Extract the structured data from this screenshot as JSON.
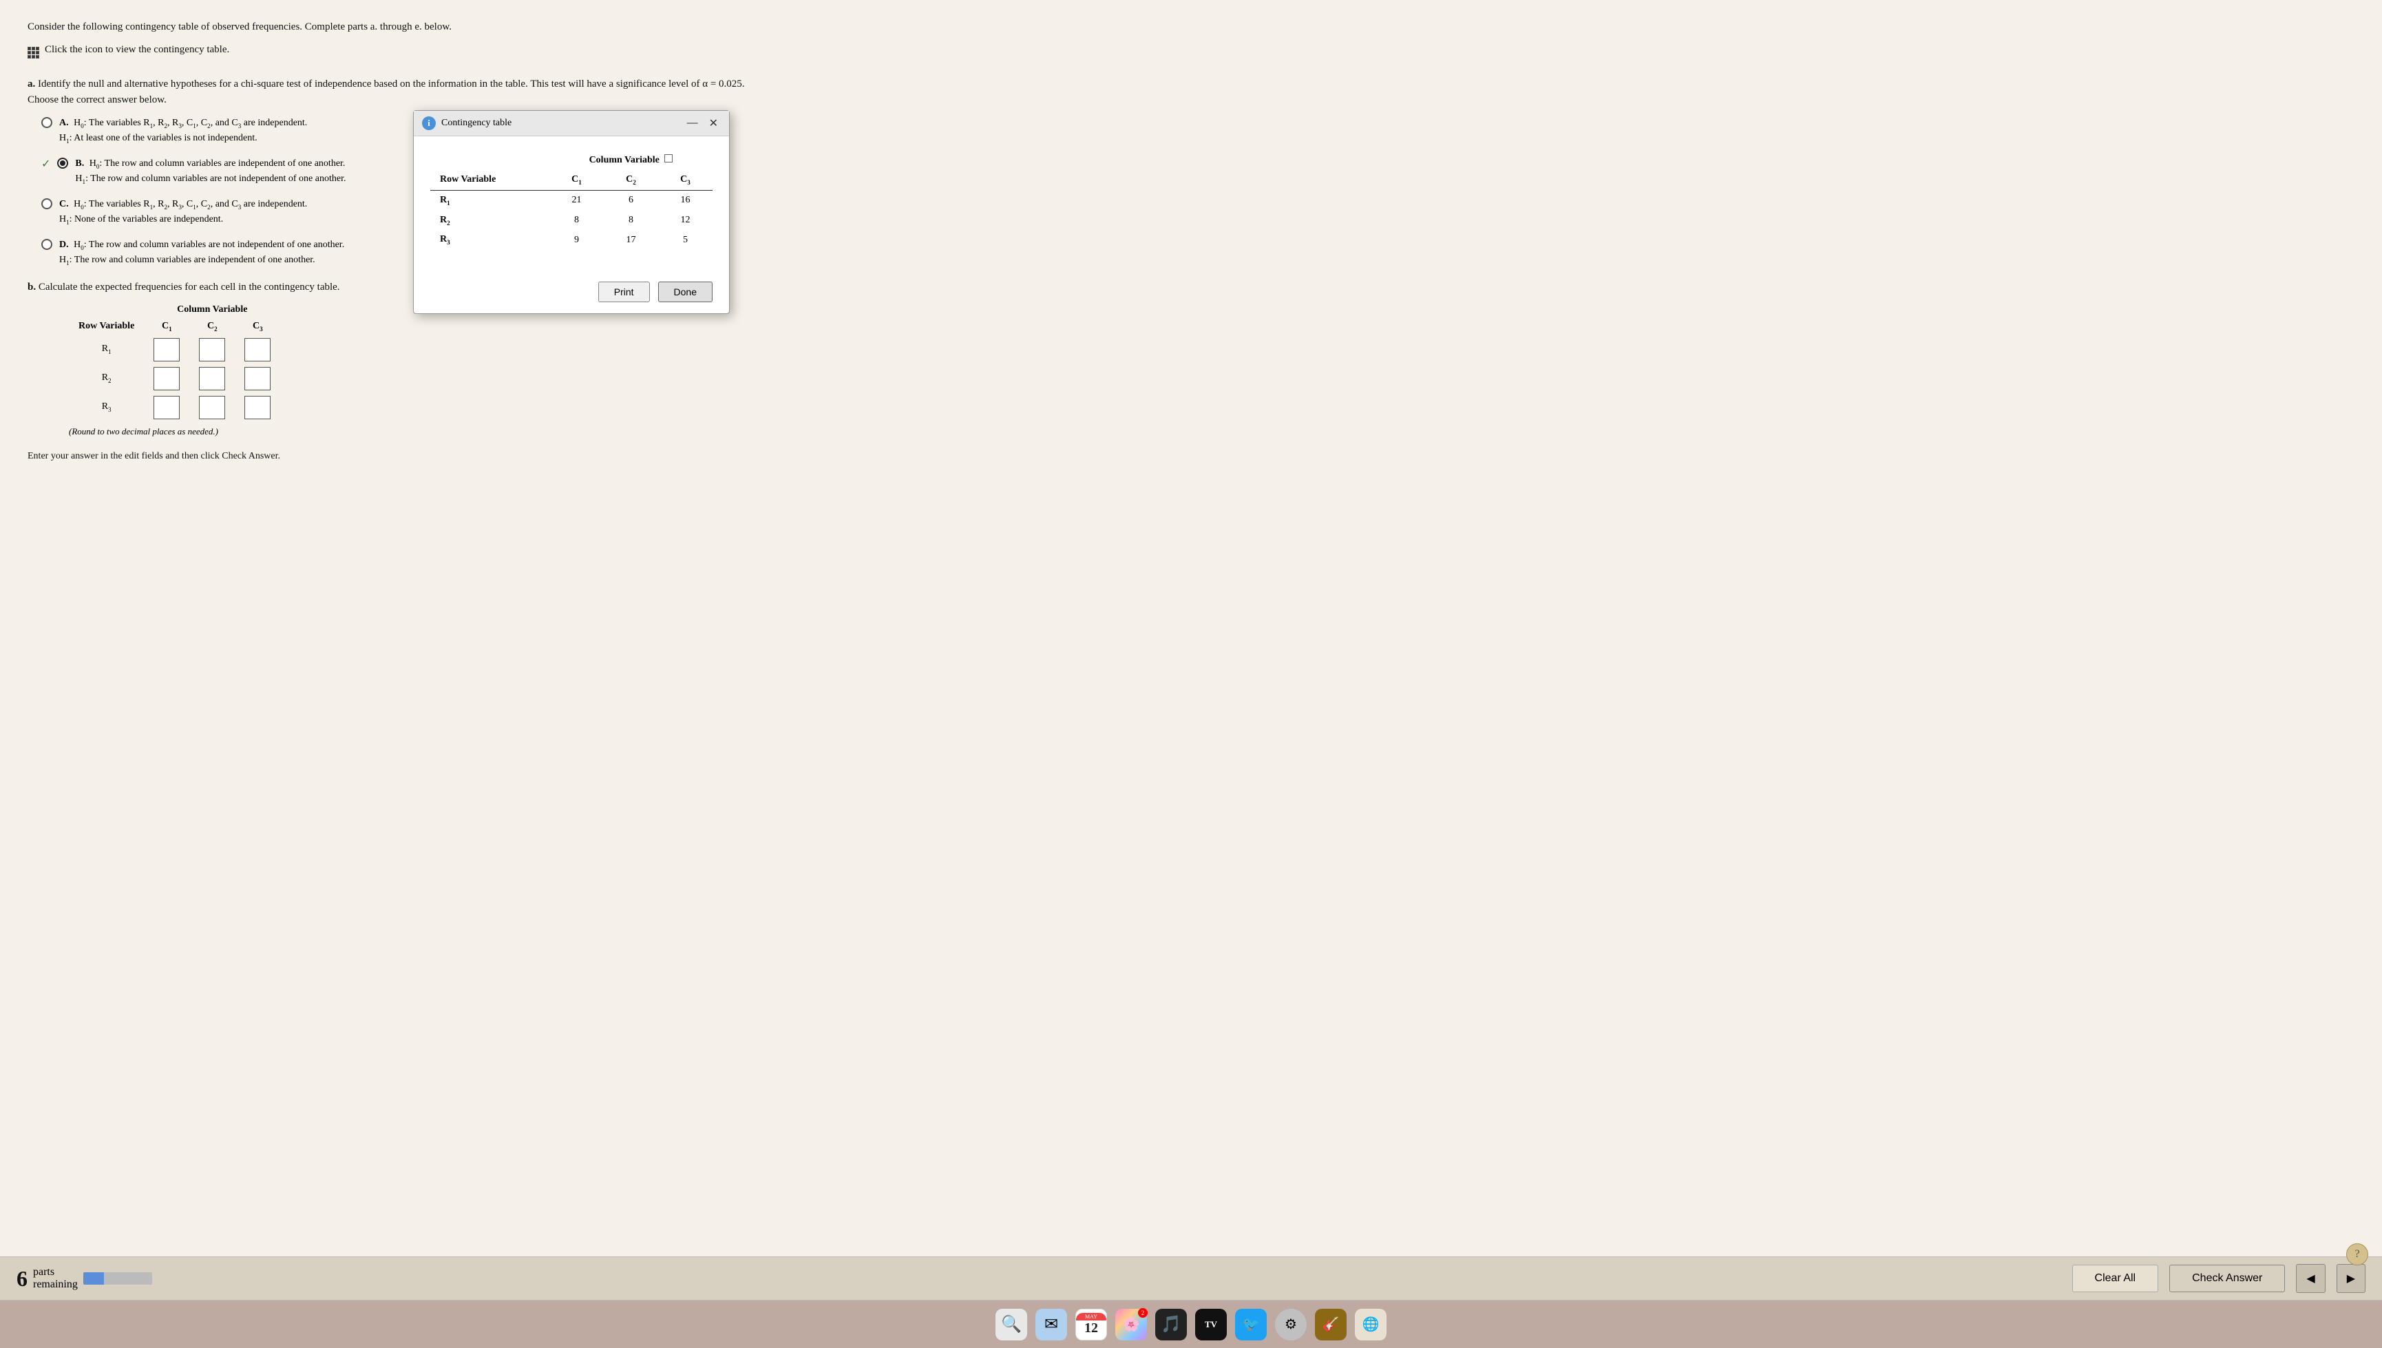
{
  "page": {
    "problem_intro": "Consider the following contingency table of observed frequencies. Complete parts a. through e. below.",
    "click_icon_text": "Click the icon to view the contingency table.",
    "part_a": {
      "label": "a.",
      "text": "Identify the null and alternative hypotheses for a chi-square test of independence based on the information in the table. This test will have a significance level of α = 0.025.",
      "choose_text": "Choose the correct answer below.",
      "options": [
        {
          "id": "A",
          "selected": false,
          "h0": "H₀: The variables R₁, R₂, R₃, C₁, C₂, and C₃ are independent.",
          "h1": "H₁: At least one of the variables is not independent."
        },
        {
          "id": "B",
          "selected": true,
          "correct": true,
          "h0": "H₀: The row and column variables are independent of one another.",
          "h1": "H₁: The row and column variables are not independent of one another."
        },
        {
          "id": "C",
          "selected": false,
          "h0": "H₀: The variables R₁, R₂, R₃, C₁, C₂, and C₃ are independent.",
          "h1": "H₁: None of the variables are independent."
        },
        {
          "id": "D",
          "selected": false,
          "h0": "H₀: The row and column variables are not independent of one another.",
          "h1": "H₁: The row and column variables are independent of one another."
        }
      ]
    },
    "part_b": {
      "label": "b.",
      "text": "Calculate the expected frequencies for each cell in the contingency table.",
      "column_header": "Column Variable",
      "row_var_label": "Row Variable",
      "col_labels": [
        "C₁",
        "C₂",
        "C₃"
      ],
      "rows": [
        {
          "label": "R₁",
          "values": [
            "",
            "",
            ""
          ]
        },
        {
          "label": "R₂",
          "values": [
            "",
            "",
            ""
          ]
        },
        {
          "label": "R₃",
          "values": [
            "",
            "",
            ""
          ]
        }
      ],
      "round_note": "(Round to two decimal places as needed.)"
    },
    "enter_answer_text": "Enter your answer in the edit fields and then click Check Answer.",
    "parts_remaining": {
      "count": "6",
      "label1": "parts",
      "label2": "remaining"
    },
    "clear_all_label": "Clear All",
    "check_answer_label": "Check Answer"
  },
  "popup": {
    "title": "Contingency table",
    "column_var_header": "Column Variable",
    "row_var_label": "Row Variable",
    "col_labels": [
      "C₁",
      "C₂",
      "C₃"
    ],
    "rows": [
      {
        "label": "R₁",
        "c1": "21",
        "c2": "6",
        "c3": "16"
      },
      {
        "label": "R₂",
        "c1": "8",
        "c2": "8",
        "c3": "12"
      },
      {
        "label": "R₃",
        "c1": "9",
        "c2": "17",
        "c3": "5"
      }
    ],
    "print_label": "Print",
    "done_label": "Done"
  },
  "dock": {
    "items": [
      {
        "emoji": "🔍",
        "color": "#ddd",
        "label": "Finder",
        "badge": ""
      },
      {
        "emoji": "✉",
        "color": "#c0d8f0",
        "label": "Mail",
        "badge": ""
      },
      {
        "emoji": "📅",
        "color": "#f0f0f0",
        "label": "MAY 12",
        "badge": ""
      },
      {
        "emoji": "📷",
        "color": "#e0c0d0",
        "label": "Photos",
        "badge": "2"
      },
      {
        "emoji": "🎵",
        "color": "#d8c0e8",
        "label": "Music",
        "badge": ""
      },
      {
        "emoji": "📺",
        "color": "#333",
        "label": "TV",
        "badge": ""
      },
      {
        "emoji": "🐦",
        "color": "#c0e0f8",
        "label": "Twitter",
        "badge": ""
      },
      {
        "emoji": "⚙",
        "color": "#e8e8e8",
        "label": "System",
        "badge": ""
      }
    ]
  }
}
